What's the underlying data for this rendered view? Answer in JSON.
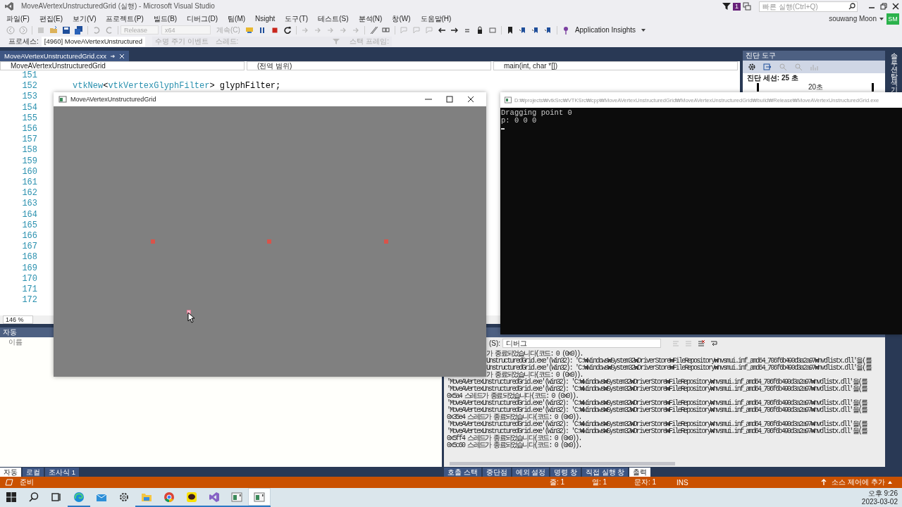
{
  "title_bar": {
    "title": "MoveAVertexUnstructuredGrid (실행) - Microsoft Visual Studio",
    "notification_count": "1",
    "quick_launch": {
      "placeholder": "빠른 실행(Ctrl+Q)"
    }
  },
  "menu": [
    "파일(F)",
    "편집(E)",
    "보기(V)",
    "프로젝트(P)",
    "빌드(B)",
    "디버그(D)",
    "팀(M)",
    "Nsight",
    "도구(T)",
    "테스트(S)",
    "분석(N)",
    "창(W)",
    "도움말(H)"
  ],
  "account": {
    "name": "souwang Moon",
    "initials": "SM"
  },
  "toolbar": {
    "configuration": {
      "label": "Release",
      "disabled": true
    },
    "platform": {
      "label": "x64",
      "disabled": true
    },
    "continue": {
      "label": "계속(C)",
      "disabled": true
    },
    "insights": {
      "label": "Application Insights",
      "disabled": false
    }
  },
  "debug_location": {
    "process_label": "프로세스:",
    "process": "[4960] MoveAVertexUnstructured",
    "lifecycle": {
      "label": "수명 주기 이벤트",
      "disabled": true
    },
    "thread": {
      "label": "스레드:",
      "disabled": true
    },
    "stack_frame": {
      "label": "스택 프레임:",
      "disabled": true
    }
  },
  "editor": {
    "tab": "MoveAVertexUnstructuredGrid.cxx",
    "nav": [
      "MoveAVertexUnstructuredGrid",
      "(전역 범위)",
      "main(int, char *[])"
    ],
    "lines": [
      {
        "number": "151"
      },
      {
        "number": "152",
        "tokens": [
          {
            "text": "vtkNew",
            "kind": "type"
          },
          {
            "text": "<",
            "kind": "plain"
          },
          {
            "text": "vtkVertexGlyphFilter",
            "kind": "type"
          },
          {
            "text": "> glyphFilter;",
            "kind": "plain"
          }
        ]
      },
      {
        "number": "153"
      },
      {
        "number": "154"
      },
      {
        "number": "155"
      },
      {
        "number": "156"
      },
      {
        "number": "157"
      },
      {
        "number": "158"
      },
      {
        "number": "159"
      },
      {
        "number": "160"
      },
      {
        "number": "161"
      },
      {
        "number": "162"
      },
      {
        "number": "163"
      },
      {
        "number": "164"
      },
      {
        "number": "165"
      },
      {
        "number": "166"
      },
      {
        "number": "167"
      },
      {
        "number": "168"
      },
      {
        "number": "169"
      },
      {
        "number": "170"
      },
      {
        "number": "171"
      },
      {
        "number": "172"
      }
    ],
    "zoom": "146 %"
  },
  "diagnostics": {
    "title": "진단 도구",
    "session": "진단 세션: 25 초",
    "timeline_label": "20초"
  },
  "solution_explorer_tab": "솔루션 탐색기",
  "autos": {
    "title": "자동",
    "column": "이름",
    "tabs": [
      {
        "label": "자동",
        "selected": true
      },
      {
        "label": "로컬",
        "selected": false
      },
      {
        "label": "조사식 1",
        "selected": false
      }
    ]
  },
  "output": {
    "source_label": "(S):",
    "source": "디버그",
    "lines": [
      {
        "text": "가 종료되었습니다(코드: 0 (0x0)).",
        "kind": "cut"
      },
      {
        "text": "UnstructuredGrid.exe'(Win32): 'C:₩Windows₩System32₩DriverStore₩FileRepository₩nvsmui.inf_amd64_706f6b490d3a2a97₩nvdlistx.dll'을(를",
        "kind": "cut"
      },
      {
        "text": "UnstructuredGrid.exe'(Win32): 'C:₩Windows₩System32₩DriverStore₩FileRepository₩nvsmui.inf_amd64_706f6b490d3a2a97₩nvdlistx.dll'을(를",
        "kind": "cut"
      },
      {
        "text": "가 종료되었습니다(코드: 0 (0x0)).",
        "kind": "cut"
      },
      {
        "text": "'MoveAVertexUnstructuredGrid.exe'(Win32): 'C:₩Windows₩System32₩DriverStore₩FileRepository₩nvsmui.inf_amd64_706f6b490d3a2a97₩nvdlistx.dll'을(를",
        "kind": "full"
      },
      {
        "text": "'MoveAVertexUnstructuredGrid.exe'(Win32): 'C:₩Windows₩System32₩DriverStore₩FileRepository₩nvsmui.inf_amd64_706f6b490d3a2a97₩nvdlistx.dll'을(를",
        "kind": "full"
      },
      {
        "text": "0x5a4 스레드가 종료되었습니다(코드: 0 (0x0)).",
        "kind": "full"
      },
      {
        "text": "'MoveAVertexUnstructuredGrid.exe'(Win32): 'C:₩Windows₩System32₩DriverStore₩FileRepository₩nvsmui.inf_amd64_706f6b490d3a2a97₩nvdlistx.dll'을(를",
        "kind": "full"
      },
      {
        "text": "'MoveAVertexUnstructuredGrid.exe'(Win32): 'C:₩Windows₩System32₩DriverStore₩FileRepository₩nvsmui.inf_amd64_706f6b490d3a2a97₩nvdlistx.dll'을(를",
        "kind": "full"
      },
      {
        "text": "0x35e4 스레드가 종료되었습니다(코드: 0 (0x0)).",
        "kind": "full"
      },
      {
        "text": "'MoveAVertexUnstructuredGrid.exe'(Win32): 'C:₩Windows₩System32₩DriverStore₩FileRepository₩nvsmui.inf_amd64_706f6b490d3a2a97₩nvdlistx.dll'을(를",
        "kind": "full"
      },
      {
        "text": "'MoveAVertexUnstructuredGrid.exe'(Win32): 'C:₩Windows₩System32₩DriverStore₩FileRepository₩nvsmui.inf_amd64_706f6b490d3a2a97₩nvdlistx.dll'을(를",
        "kind": "full"
      },
      {
        "text": "0x5ff4 스레드가 종료되었습니다(코드: 0 (0x0)).",
        "kind": "full"
      },
      {
        "text": "0x5c60 스레드가 종료되었습니다(코드: 0 (0x0)).",
        "kind": "full"
      }
    ],
    "tabs": [
      {
        "label": "호출 스택",
        "selected": false
      },
      {
        "label": "중단점",
        "selected": false
      },
      {
        "label": "예외 설정",
        "selected": false
      },
      {
        "label": "명령 창",
        "selected": false
      },
      {
        "label": "직접 실행 창",
        "selected": false
      },
      {
        "label": "출력",
        "selected": true
      }
    ]
  },
  "status_bar": {
    "message": "준비",
    "line": "줄: 1",
    "column": "열: 1",
    "char": "문자: 1",
    "mode": "INS",
    "source_control": "소스 제어에 추가"
  },
  "taskbar": {
    "time": "오후 9:26",
    "date": "2023-03-02",
    "apps": [
      {
        "kind": "start",
        "running": false,
        "selected": false
      },
      {
        "kind": "search",
        "running": false,
        "selected": false
      },
      {
        "kind": "taskview",
        "running": false,
        "selected": false
      },
      {
        "kind": "edge",
        "running": true,
        "selected": false
      },
      {
        "kind": "mail",
        "running": false,
        "selected": false
      },
      {
        "kind": "settings",
        "running": false,
        "selected": false
      },
      {
        "kind": "explorer",
        "running": true,
        "selected": false
      },
      {
        "kind": "chrome",
        "running": true,
        "selected": false
      },
      {
        "kind": "chat",
        "running": true,
        "selected": false
      },
      {
        "kind": "studio",
        "running": true,
        "selected": false
      },
      {
        "kind": "app",
        "running": true,
        "selected": false
      },
      {
        "kind": "app",
        "running": true,
        "selected": true
      }
    ]
  },
  "vtk_window": {
    "title": "MoveAVertexUnstructuredGrid",
    "points": [
      {
        "selected": false
      },
      {
        "selected": false
      },
      {
        "selected": false
      },
      {
        "selected": true
      }
    ]
  },
  "console": {
    "title": "D:₩projects₩vtkSrc₩VTKSrc₩cpp₩MoveAVertexUnstructuredGrid₩MoveAVertexUnstructuredGrid₩build₩Release₩MoveAVertexUnstructuredGrid.exe",
    "lines": [
      "Dragging point 0",
      "p: 0 0 0"
    ]
  }
}
